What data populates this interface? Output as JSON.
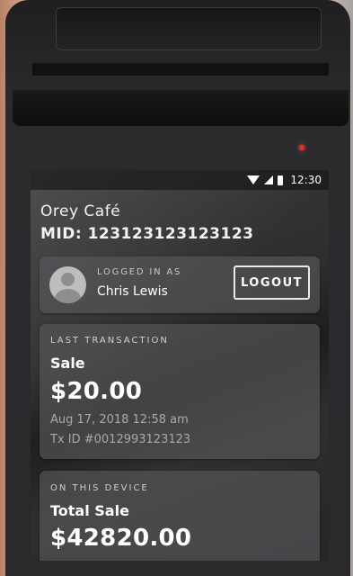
{
  "status_bar": {
    "time": "12:30"
  },
  "merchant": {
    "name": "Orey Café",
    "mid": "MID: 123123123123123"
  },
  "session": {
    "logged_label": "LOGGED IN AS",
    "user_name": "Chris Lewis",
    "logout_label": "LOGOUT"
  },
  "last_transaction": {
    "eyebrow": "LAST TRANSACTION",
    "type": "Sale",
    "amount": "$20.00",
    "datetime": "Aug 17, 2018 12:58 am",
    "tx_id": "Tx ID #0012993123123"
  },
  "device_summary": {
    "eyebrow": "ON THIS DEVICE",
    "type": "Total Sale",
    "amount": "$42820.00"
  },
  "colors": {
    "led": "#e0332f",
    "card_bg": "#5a5a5e",
    "text_primary": "#ffffff",
    "text_muted": "#a9a9a9"
  }
}
